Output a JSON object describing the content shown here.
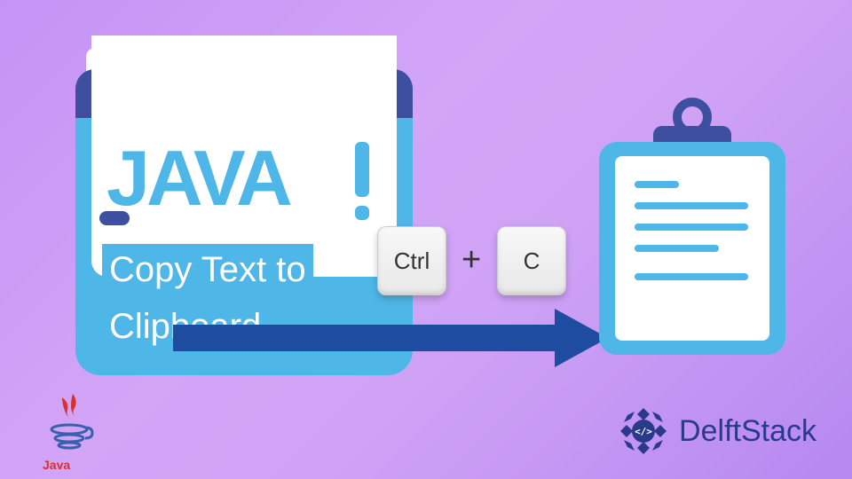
{
  "browser": {
    "java_word": "JAVA",
    "copy_line1": "Copy Text to",
    "copy_line2": "Clipboard"
  },
  "keys": {
    "ctrl": "Ctrl",
    "plus": "+",
    "c": "C"
  },
  "logos": {
    "java": "Java",
    "delftstack": "DelftStack"
  },
  "colors": {
    "window_frame": "#3d4f9e",
    "accent_blue": "#4fb6e8",
    "arrow": "#1e4ca0",
    "bg_gradient_start": "#c593f5",
    "bg_gradient_end": "#b688f0"
  }
}
